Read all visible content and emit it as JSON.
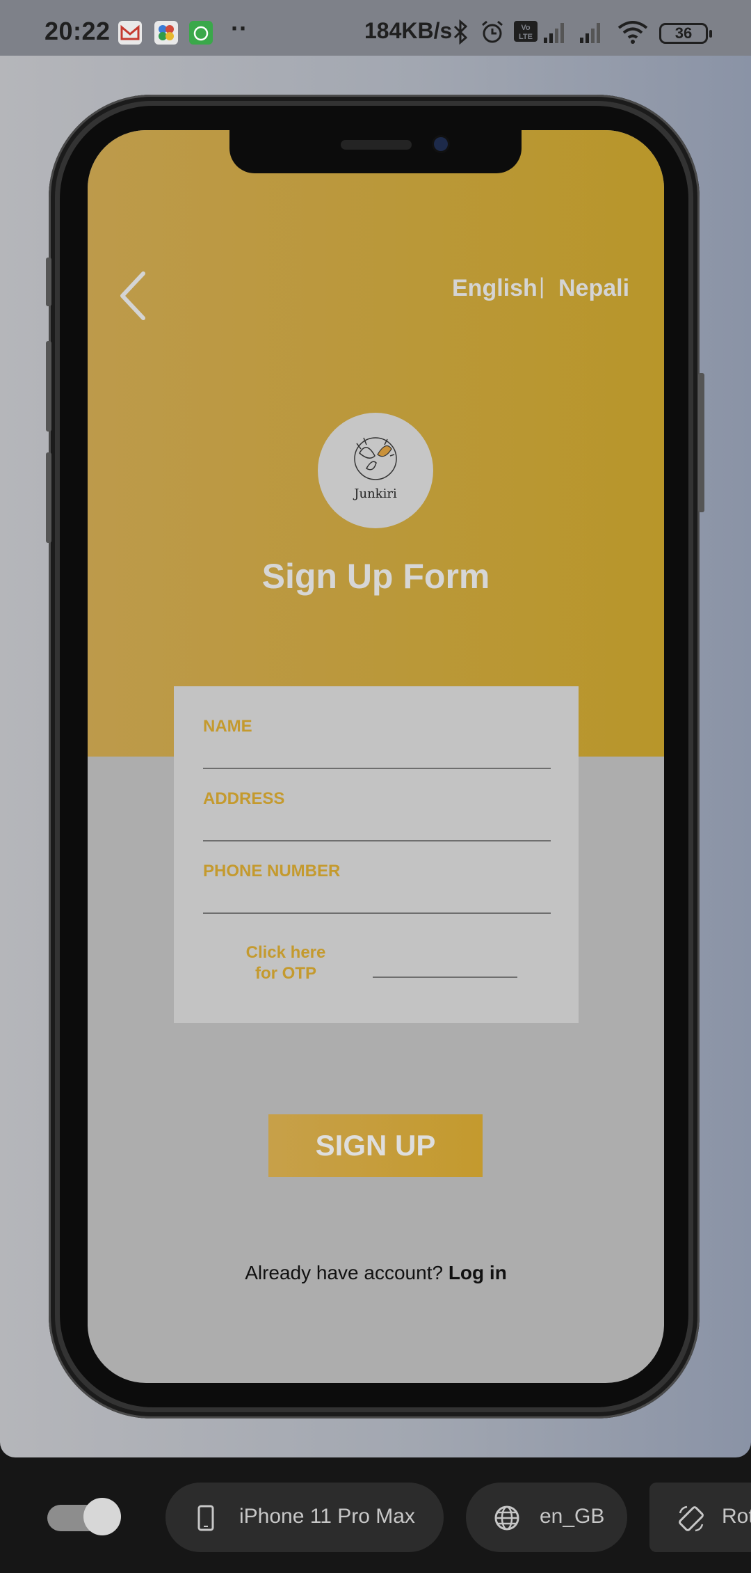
{
  "status_bar": {
    "time": "20:22",
    "network_speed": "184KB/s",
    "battery": "36",
    "icons": [
      "gmail-icon",
      "photos-icon",
      "app-icon",
      "bluetooth-icon",
      "alarm-icon",
      "volte-icon",
      "signal-icon",
      "signal-icon",
      "wifi-icon",
      "battery-icon"
    ]
  },
  "app": {
    "languages": {
      "english": "English",
      "separator": "|",
      "nepali": "Nepali"
    },
    "logo_text": "Junkiri",
    "title": "Sign Up Form",
    "form": {
      "name_label": "NAME",
      "address_label": "ADDRESS",
      "phone_label": "PHONE NUMBER",
      "otp_label": "Click here for OTP"
    },
    "signup_button": "SIGN UP",
    "login_prompt": "Already have account?",
    "login_link": "Log in"
  },
  "toolbar": {
    "device": "iPhone 11 Pro Max",
    "locale": "en_GB",
    "rotate": "Rot"
  },
  "colors": {
    "accent": "#c49a2e",
    "header": "#b8962a",
    "card": "#c3c3c3"
  }
}
